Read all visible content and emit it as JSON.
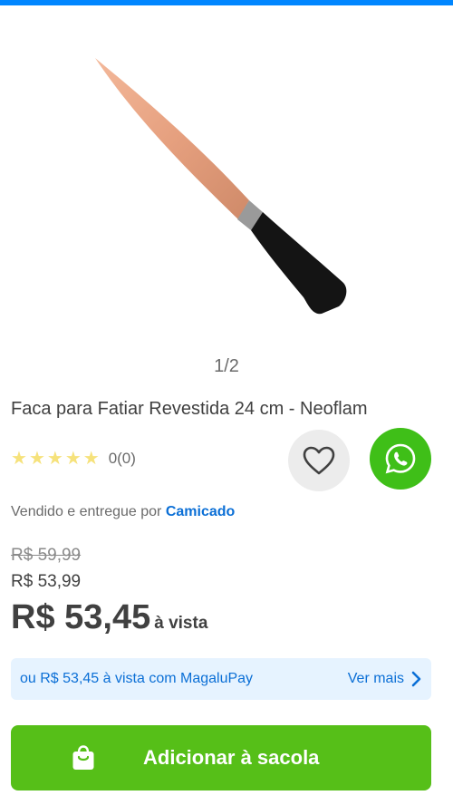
{
  "colors": {
    "top_bar": "#0086ff",
    "accent_blue": "#0b6fd6",
    "green_button": "#56bf18",
    "whatsapp_green": "#3fbf18",
    "star_color": "#f6e27b",
    "banner_bg": "#e6f3ff"
  },
  "gallery": {
    "pager_text": "1/2",
    "image_subject": "knife-product-image"
  },
  "product": {
    "title": "Faca para Fatiar Revestida 24 cm - Neoflam",
    "rating_count": "0(0)",
    "stars": 0
  },
  "actions": {
    "favorite_icon": "heart-icon",
    "share_icon": "whatsapp-icon"
  },
  "seller": {
    "prefix": "Vendido e entregue por",
    "name": "Camicado"
  },
  "price": {
    "old": "R$ 59,99",
    "list": "R$ 53,99",
    "main": "R$ 53,45",
    "main_suffix": "à vista"
  },
  "payment_banner": {
    "text": "ou R$ 53,45 à vista com MagaluPay",
    "link": "Ver mais"
  },
  "cta": {
    "label": "Adicionar à sacola",
    "icon": "shopping-bag-icon"
  }
}
